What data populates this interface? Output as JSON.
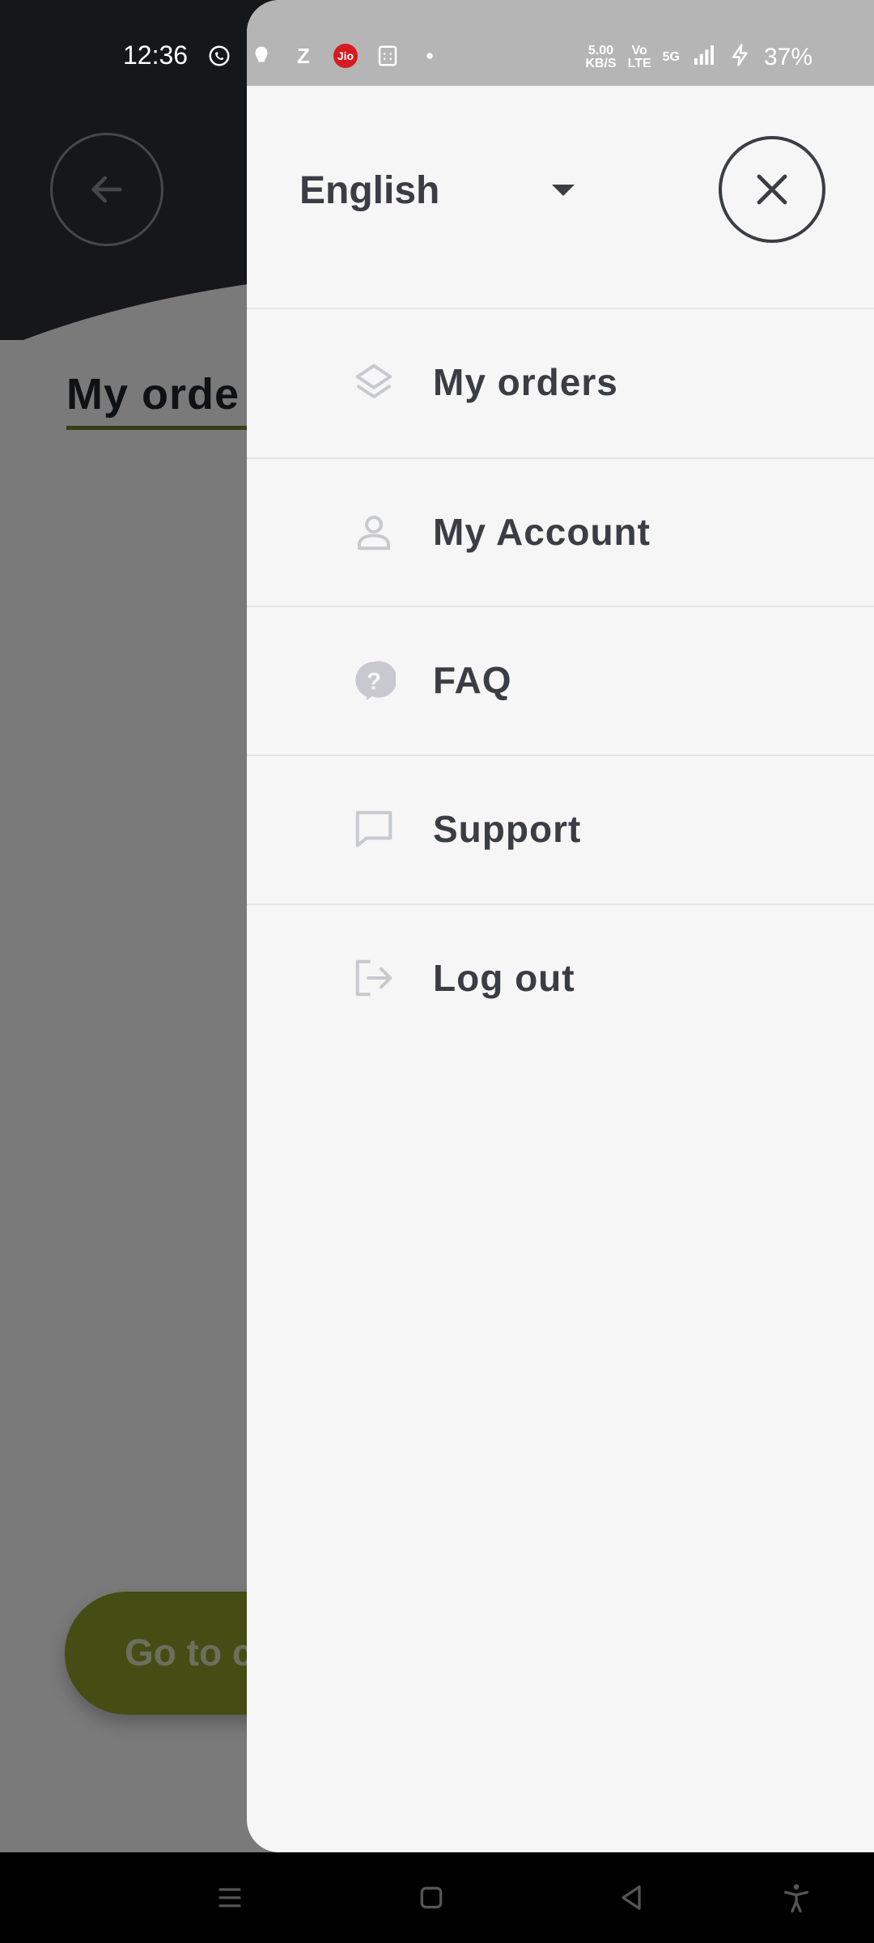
{
  "status_bar": {
    "time": "12:36",
    "net_speed_top": "5.00",
    "net_speed_bottom": "KB/S",
    "volte_top": "Vo",
    "volte_bottom": "LTE",
    "network": "5G",
    "battery": "37%",
    "jio": "Jio"
  },
  "background": {
    "page_title": "My orde",
    "cta_label": "Go to c"
  },
  "drawer": {
    "language": "English",
    "menu": [
      {
        "label": "My orders",
        "icon": "layers-icon"
      },
      {
        "label": "My Account",
        "icon": "user-icon"
      },
      {
        "label": "FAQ",
        "icon": "help-icon"
      },
      {
        "label": "Support",
        "icon": "chat-icon"
      },
      {
        "label": "Log out",
        "icon": "logout-icon"
      }
    ]
  },
  "colors": {
    "header_dark": "#2b2e34",
    "accent_green": "#8a9a2a",
    "drawer_bg": "#f6f6f6",
    "text_dark": "#3a3d44",
    "icon_gray": "#c7c9cf"
  }
}
